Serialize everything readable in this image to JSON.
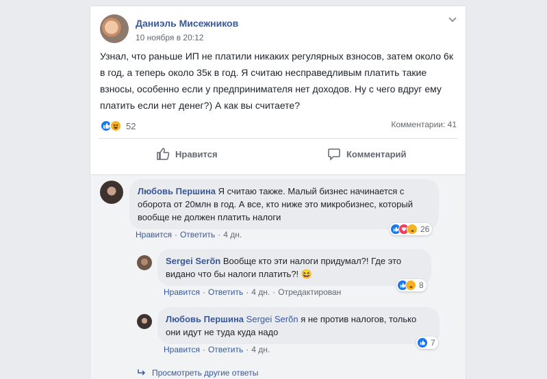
{
  "post": {
    "author": "Даниэль Мисежников",
    "time": "10 ноября в 20:12",
    "text": "Узнал, что раньше ИП не платили никаких регулярных взносов, затем около 6к в год, а теперь около 35к в год. Я считаю несправедливым платить такие взносы, особенно если у предпринимателя нет доходов. Ну с чего вдруг ему платить если нет денег?) А как вы считаете?",
    "reaction_count": "52",
    "comments_label": "Комментарии: 41"
  },
  "actions": {
    "like": "Нравится",
    "comment": "Комментарий"
  },
  "comments": [
    {
      "author": "Любовь Першина",
      "text": "Я считаю также. Малый бизнес начинается с оборота от 20млн в год. А все, кто ниже это микробизнес, который вообще не должен платить налоги",
      "like": "Нравится",
      "reply": "Ответить",
      "age": "4 дн.",
      "reactions": "26"
    },
    {
      "author": "Sergei Serõn",
      "text": "Вообще кто эти налоги придумал?! Где это видано что бы налоги платить?!",
      "emoji": "😆",
      "like": "Нравится",
      "reply": "Ответить",
      "age": "4 дн.",
      "edited": "Отредактирован",
      "reactions": "8"
    },
    {
      "author": "Любовь Першина",
      "mention": "Sergei Serõn",
      "text": "я не против налогов, только они идут не туда куда надо",
      "like": "Нравится",
      "reply": "Ответить",
      "age": "4 дн.",
      "reactions": "7"
    }
  ],
  "more_replies": "Просмотреть другие ответы",
  "colors": {
    "link": "#385898",
    "like_blue": "#1877f2",
    "haha_yellow": "#f7b125",
    "love_red": "#f33e58",
    "bubble": "#e9ebee"
  }
}
